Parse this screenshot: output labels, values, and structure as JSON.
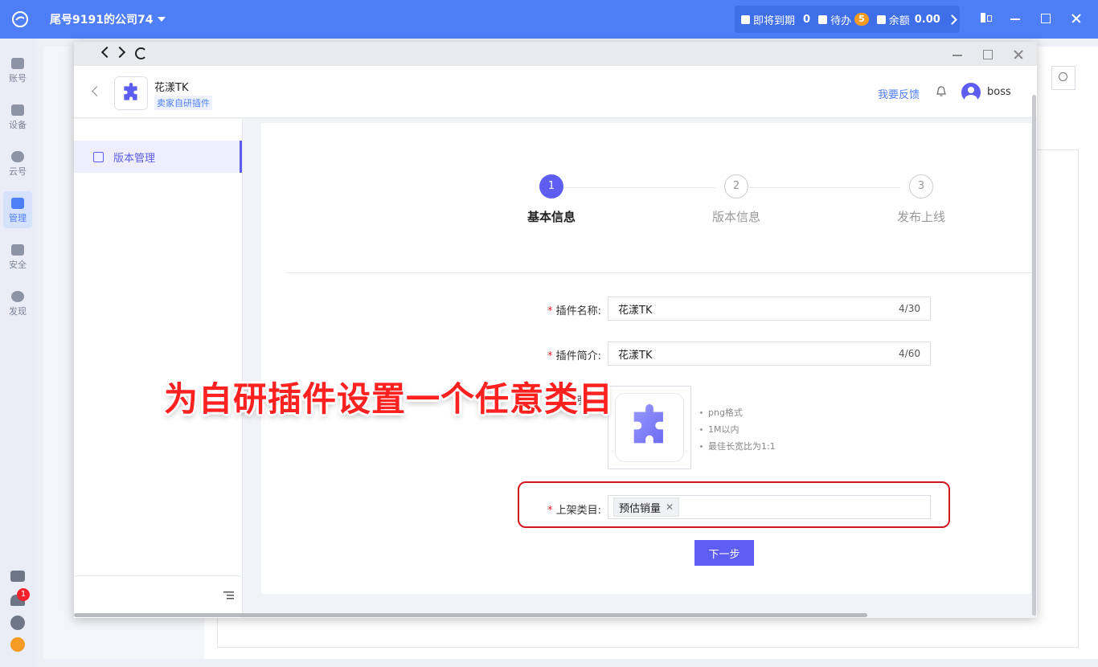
{
  "topbar": {
    "company": "尾号9191的公司74",
    "expiring_label": "即将到期",
    "expiring_count": "0",
    "todo_label": "待办",
    "todo_count": "5",
    "balance_label": "余额",
    "balance_value": "0.00"
  },
  "app_sidebar": {
    "items": [
      {
        "label": "账号",
        "icon": "account-icon"
      },
      {
        "label": "设备",
        "icon": "device-icon"
      },
      {
        "label": "云号",
        "icon": "cloud-icon"
      },
      {
        "label": "管理",
        "icon": "manage-icon"
      },
      {
        "label": "安全",
        "icon": "security-icon"
      },
      {
        "label": "发现",
        "icon": "discover-icon"
      }
    ],
    "notification_count": "1"
  },
  "window": {
    "header": {
      "plugin_name": "花漾TK",
      "plugin_tag": "卖家自研插件",
      "feedback": "我要反馈",
      "username": "boss"
    },
    "menu": {
      "items": [
        {
          "label": "版本管理"
        }
      ]
    },
    "steps": [
      {
        "num": "1",
        "label": "基本信息"
      },
      {
        "num": "2",
        "label": "版本信息"
      },
      {
        "num": "3",
        "label": "发布上线"
      }
    ],
    "form": {
      "name_label": "插件名称:",
      "name_value": "花漾TK",
      "name_count": "4/30",
      "intro_label": "插件简介:",
      "intro_value": "花漾TK",
      "intro_count": "4/60",
      "icon_label": "件图标:",
      "icon_hints": [
        "png格式",
        "1M以内",
        "最佳长宽比为1:1"
      ],
      "category_label": "上架类目:",
      "category_tag": "预估销量",
      "next_button": "下一步"
    }
  },
  "overlay_caption": "为自研插件设置一个任意类目",
  "colors": {
    "topbar": "#4e7ef8",
    "primary": "#5d5df1",
    "highlight": "#d0191e",
    "caption": "#ff2020"
  }
}
